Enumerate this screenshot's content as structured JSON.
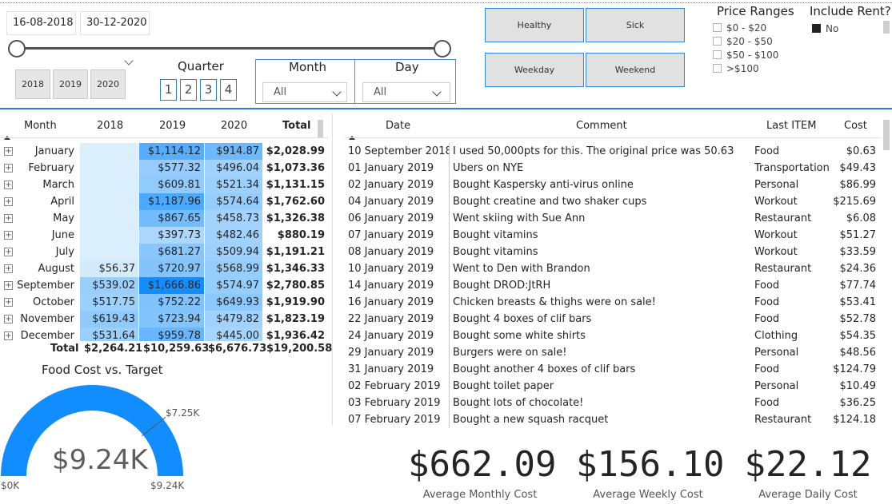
{
  "date_slicer": {
    "start": "16-08-2018",
    "end": "30-12-2020"
  },
  "years": [
    "2018",
    "2019",
    "2020"
  ],
  "quarter": {
    "title": "Quarter",
    "options": [
      "1",
      "2",
      "3",
      "4"
    ]
  },
  "month_slicer": {
    "title": "Month",
    "value": "All"
  },
  "day_slicer": {
    "title": "Day",
    "value": "All"
  },
  "tiles": {
    "healthy": "Healthy",
    "sick": "Sick",
    "weekday": "Weekday",
    "weekend": "Weekend"
  },
  "price_ranges": {
    "title": "Price Ranges",
    "options": [
      "$0 - $20",
      "$20 - $50",
      "$50 - $100",
      ">$100"
    ]
  },
  "include_rent": {
    "title": "Include Rent?",
    "option": "No"
  },
  "matrix": {
    "headers": {
      "month": "Month",
      "y2018": "2018",
      "y2019": "2019",
      "y2020": "2020",
      "total": "Total"
    },
    "rows": [
      {
        "month": "January",
        "y2018": "",
        "y2019": "$1,114.12",
        "y2020": "$914.87",
        "total": "$2,028.99"
      },
      {
        "month": "February",
        "y2018": "",
        "y2019": "$577.32",
        "y2020": "$496.04",
        "total": "$1,073.36"
      },
      {
        "month": "March",
        "y2018": "",
        "y2019": "$609.81",
        "y2020": "$521.34",
        "total": "$1,131.15"
      },
      {
        "month": "April",
        "y2018": "",
        "y2019": "$1,187.96",
        "y2020": "$574.64",
        "total": "$1,762.60"
      },
      {
        "month": "May",
        "y2018": "",
        "y2019": "$867.65",
        "y2020": "$458.73",
        "total": "$1,326.38"
      },
      {
        "month": "June",
        "y2018": "",
        "y2019": "$397.73",
        "y2020": "$482.46",
        "total": "$880.19"
      },
      {
        "month": "July",
        "y2018": "",
        "y2019": "$681.27",
        "y2020": "$509.94",
        "total": "$1,191.21"
      },
      {
        "month": "August",
        "y2018": "$56.37",
        "y2019": "$720.97",
        "y2020": "$568.99",
        "total": "$1,346.33"
      },
      {
        "month": "September",
        "y2018": "$539.02",
        "y2019": "$1,666.86",
        "y2020": "$574.97",
        "total": "$2,780.85"
      },
      {
        "month": "October",
        "y2018": "$517.75",
        "y2019": "$752.22",
        "y2020": "$649.93",
        "total": "$1,919.90"
      },
      {
        "month": "November",
        "y2018": "$619.43",
        "y2019": "$723.94",
        "y2020": "$479.82",
        "total": "$1,823.19"
      },
      {
        "month": "December",
        "y2018": "$531.64",
        "y2019": "$959.78",
        "y2020": "$445.00",
        "total": "$1,936.42"
      }
    ],
    "totals": {
      "label": "Total",
      "y2018": "$2,264.21",
      "y2019": "$10,259.63",
      "y2020": "$6,676.73",
      "total": "$19,200.58"
    }
  },
  "table": {
    "headers": {
      "date": "Date",
      "comment": "Comment",
      "item": "Last ITEM",
      "cost": "Cost"
    },
    "rows": [
      {
        "date": "10 September 2018",
        "comment": "I used 50,000pts for this. The original price was 50.63",
        "item": "Food",
        "cost": "$0.63"
      },
      {
        "date": "01 January 2019",
        "comment": "Ubers on NYE",
        "item": "Transportation",
        "cost": "$49.43"
      },
      {
        "date": "02 January 2019",
        "comment": "Bought Kaspersky anti-virus online",
        "item": "Personal",
        "cost": "$86.99"
      },
      {
        "date": "04 January 2019",
        "comment": "Bought creatine and two shaker cups",
        "item": "Workout",
        "cost": "$215.69"
      },
      {
        "date": "06 January 2019",
        "comment": "Went skiing with Sue Ann",
        "item": "Restaurant",
        "cost": "$6.08"
      },
      {
        "date": "07 January 2019",
        "comment": "Bought vitamins",
        "item": "Workout",
        "cost": "$51.27"
      },
      {
        "date": "08 January 2019",
        "comment": "Bought vitamins",
        "item": "Workout",
        "cost": "$33.59"
      },
      {
        "date": "10 January 2019",
        "comment": "Went to Den with Brandon",
        "item": "Restaurant",
        "cost": "$24.36"
      },
      {
        "date": "14 January 2019",
        "comment": "Bought DROD:JtRH",
        "item": "Food",
        "cost": "$77.74"
      },
      {
        "date": "16 January 2019",
        "comment": "Chicken breasts & thighs were on sale!",
        "item": "Food",
        "cost": "$53.41"
      },
      {
        "date": "22 January 2019",
        "comment": "Bought 4 boxes of clif bars",
        "item": "Food",
        "cost": "$52.78"
      },
      {
        "date": "24 January 2019",
        "comment": "Bought some white shirts",
        "item": "Clothing",
        "cost": "$54.35"
      },
      {
        "date": "29 January 2019",
        "comment": "Burgers were on sale!",
        "item": "Personal",
        "cost": "$48.56"
      },
      {
        "date": "31 January 2019",
        "comment": "Bought another 4 boxes of clif bars",
        "item": "Food",
        "cost": "$124.79"
      },
      {
        "date": "02 February 2019",
        "comment": "Bought toilet paper",
        "item": "Personal",
        "cost": "$10.49"
      },
      {
        "date": "03 February 2019",
        "comment": "Bought lots of chocolate!",
        "item": "Food",
        "cost": "$36.25"
      },
      {
        "date": "07 February 2019",
        "comment": "Bought a new squash racquet",
        "item": "Restaurant",
        "cost": "$124.18"
      }
    ]
  },
  "gauge": {
    "title": "Food Cost vs. Target",
    "value_label": "$9.24K",
    "target_label": "$7.25K",
    "min_label": "$0K",
    "max_label": "$9.24K",
    "value": 9.24,
    "target": 7.25,
    "min": 0,
    "max": 9.24,
    "color": "#118dff"
  },
  "kpis": [
    {
      "value": "$662.09",
      "label": "Average Monthly Cost"
    },
    {
      "value": "$156.10",
      "label": "Average Weekly Cost"
    },
    {
      "value": "$22.12",
      "label": "Average Daily Cost"
    }
  ],
  "colors": {
    "accent": "#2b7fd9",
    "heat_low": "#dbeefc",
    "heat_high": "#118dff"
  }
}
